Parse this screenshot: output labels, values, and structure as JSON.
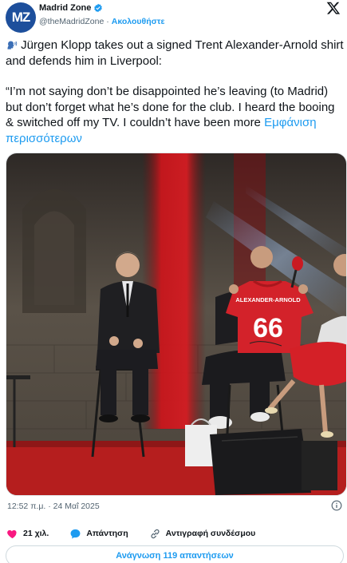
{
  "account": {
    "display_name": "Madrid Zone",
    "handle": "@theMadridZone",
    "separator": "·",
    "follow_label": "Ακολουθήστε",
    "avatar_text": "MZ"
  },
  "tweet": {
    "line1": "Jürgen Klopp takes out a signed Trent Alexander-Arnold shirt and defends him in Liverpool:",
    "line2": "“I’m not saying don’t be disappointed he’s leaving (to Madrid) but don’t forget what he’s done for the club. I heard the booing & switched off my TV. I couldn’t have been more",
    "show_more": "Εμφάνιση περισσότερων",
    "emoji_icon": "speaking-head-icon"
  },
  "media": {
    "shirt_name": "ALEXANDER-ARNOLD",
    "shirt_number": "66",
    "colors": {
      "stage_red": "#c9161c",
      "shirt_red": "#d3222a",
      "floor": "#b51e1e",
      "wall": "#5a5248"
    }
  },
  "meta": {
    "timestamp": "12:52 π.μ. · 24 Μαΐ 2025"
  },
  "actions": {
    "likes": "21 χιλ.",
    "reply": "Απάντηση",
    "copy_link": "Αντιγραφή συνδέσμου"
  },
  "footer": {
    "read_replies": "Ανάγνωση 119 απαντήσεων"
  },
  "colors": {
    "accent": "#1d9bf0",
    "like": "#f91880",
    "text": "#0f1419",
    "muted": "#536471"
  }
}
